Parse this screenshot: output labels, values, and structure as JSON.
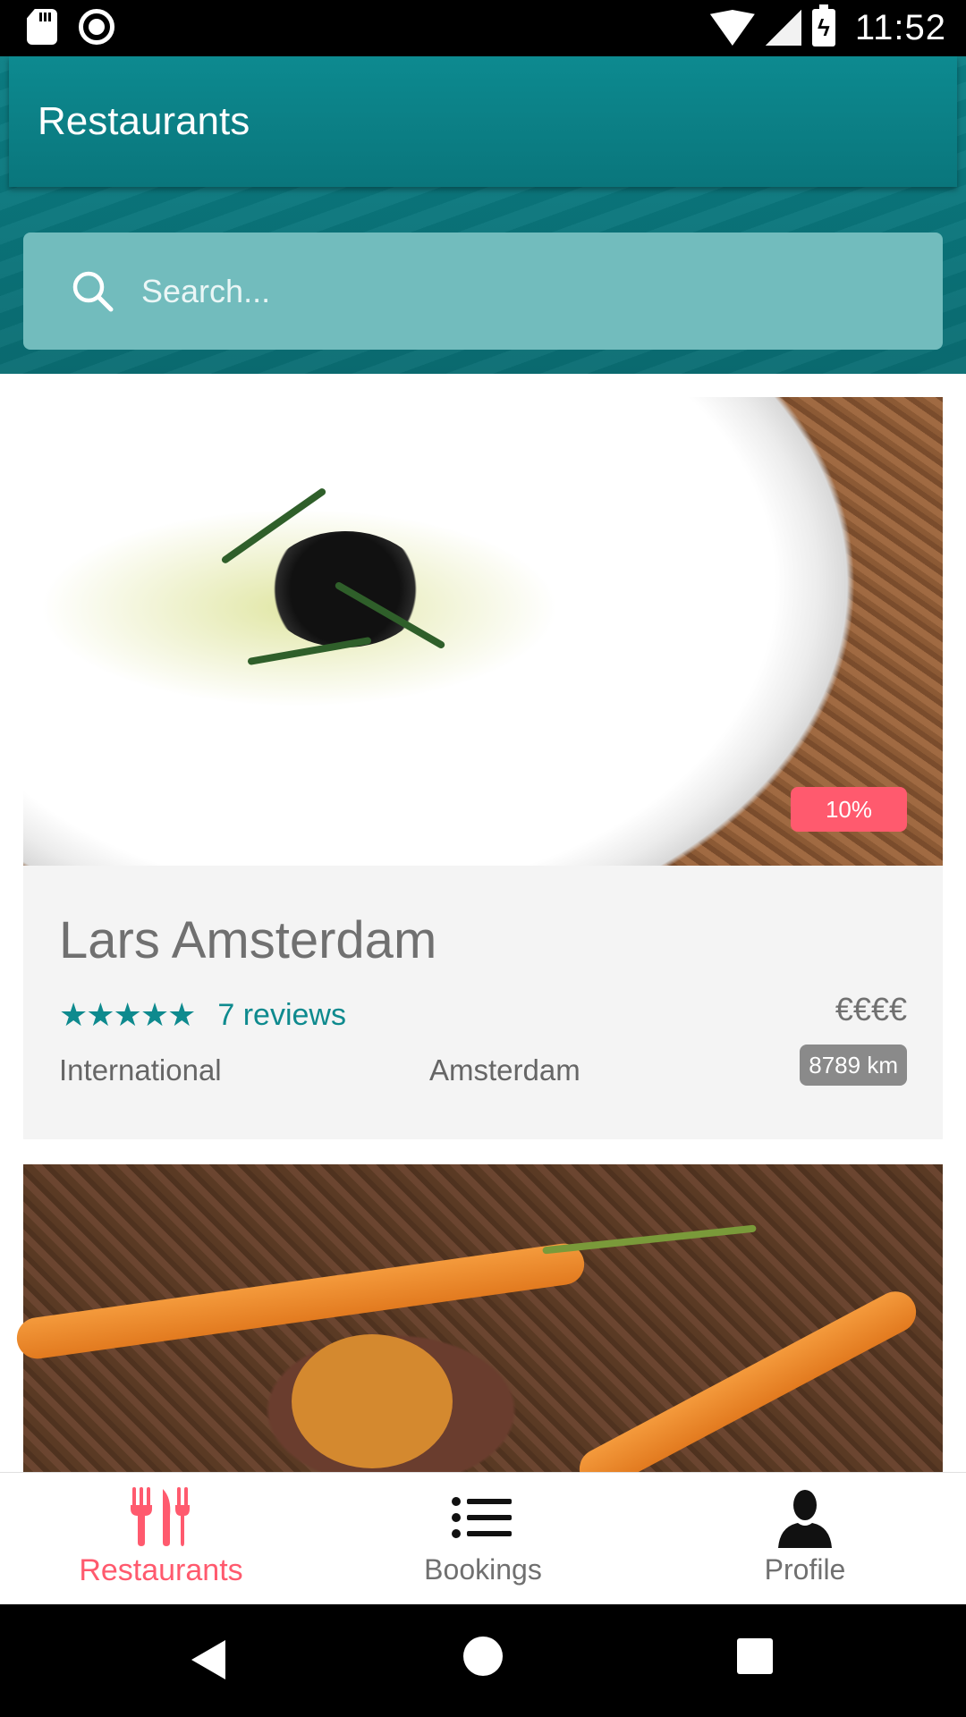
{
  "status_bar": {
    "time": "11:52",
    "icons": [
      "sd-card-icon",
      "record-icon",
      "wifi-icon",
      "signal-icon",
      "battery-charging-icon"
    ]
  },
  "toolbar": {
    "title": "Restaurants"
  },
  "search": {
    "placeholder": "Search...",
    "value": ""
  },
  "restaurants": [
    {
      "name": "Lars Amsterdam",
      "discount": "10%",
      "stars": "★★★★★",
      "reviews": "7 reviews",
      "price": "€€€€",
      "cuisine": "International",
      "city": "Amsterdam",
      "distance": "8789 km"
    }
  ],
  "bottom_nav": {
    "items": [
      {
        "label": "Restaurants",
        "icon": "fork-knife-icon",
        "active": true
      },
      {
        "label": "Bookings",
        "icon": "list-icon",
        "active": false
      },
      {
        "label": "Profile",
        "icon": "person-icon",
        "active": false
      }
    ]
  },
  "colors": {
    "primary": "#0b7f85",
    "search_bg": "#72bcbd",
    "accent": "#ff5a6e",
    "star": "#0e8a8e",
    "distance_badge": "#8a8a8a"
  }
}
